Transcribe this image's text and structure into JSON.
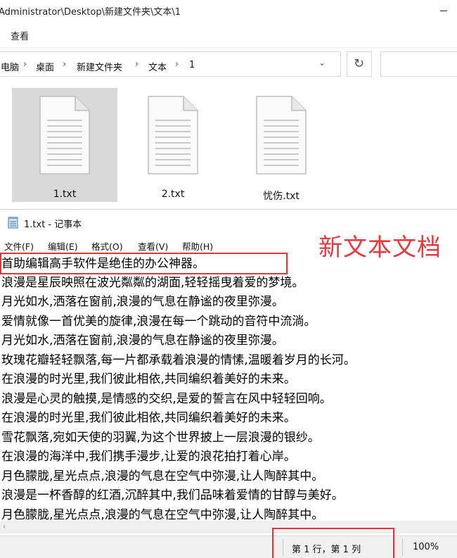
{
  "explorer": {
    "title": "Administrator\\Desktop\\新建文件夹\\文本\\1",
    "ribbon_view": "查看",
    "breadcrumb": [
      "电脑",
      "桌面",
      "新建文件夹",
      "文本",
      "1"
    ],
    "files": [
      {
        "name": "1.txt",
        "selected": true
      },
      {
        "name": "2.txt",
        "selected": false
      },
      {
        "name": "忧伤.txt",
        "selected": false
      }
    ]
  },
  "notepad": {
    "title": "1.txt - 记事本",
    "menu": [
      "文件(F)",
      "编辑(E)",
      "格式(O)",
      "查看(V)",
      "帮助(H)"
    ],
    "lines": [
      "首助编辑高手软件是绝佳的办公神器。",
      "浪漫是星辰映照在波光粼粼的湖面,轻轻摇曳着爱的梦境。",
      "月光如水,洒落在窗前,浪漫的气息在静谧的夜里弥漫。",
      "爱情就像一首优美的旋律,浪漫在每一个跳动的音符中流淌。",
      "月光如水,洒落在窗前,浪漫的气息在静谧的夜里弥漫。",
      "玫瑰花瓣轻轻飘落,每一片都承载着浪漫的情愫,温暖着岁月的长河。",
      "在浪漫的时光里,我们彼此相依,共同编织着美好的未来。",
      "浪漫是心灵的触摸,是情感的交织,是爱的誓言在风中轻轻回响。",
      "在浪漫的时光里,我们彼此相依,共同编织着美好的未来。",
      "雪花飘落,宛如天使的羽翼,为这个世界披上一层浪漫的银纱。",
      "在浪漫的海洋中,我们携手漫步,让爱的浪花拍打着心岸。",
      "月色朦胧,星光点点,浪漫的气息在空气中弥漫,让人陶醉其中。",
      "浪漫是一杯香醇的红酒,沉醉其中,我们品味着爱情的甘醇与美好。",
      "月色朦胧,星光点点,浪漫的气息在空气中弥漫,让人陶醉其中。"
    ],
    "status": {
      "position": "第 1 行，第 1 列",
      "zoom": "100%"
    }
  },
  "annotation": {
    "label": "新文本文档",
    "color": "#e8383d"
  },
  "icons": {
    "doc": "text-file-icon",
    "notepad": "notepad-icon",
    "refresh": "refresh-icon",
    "chevron": "chevron-right-icon"
  }
}
